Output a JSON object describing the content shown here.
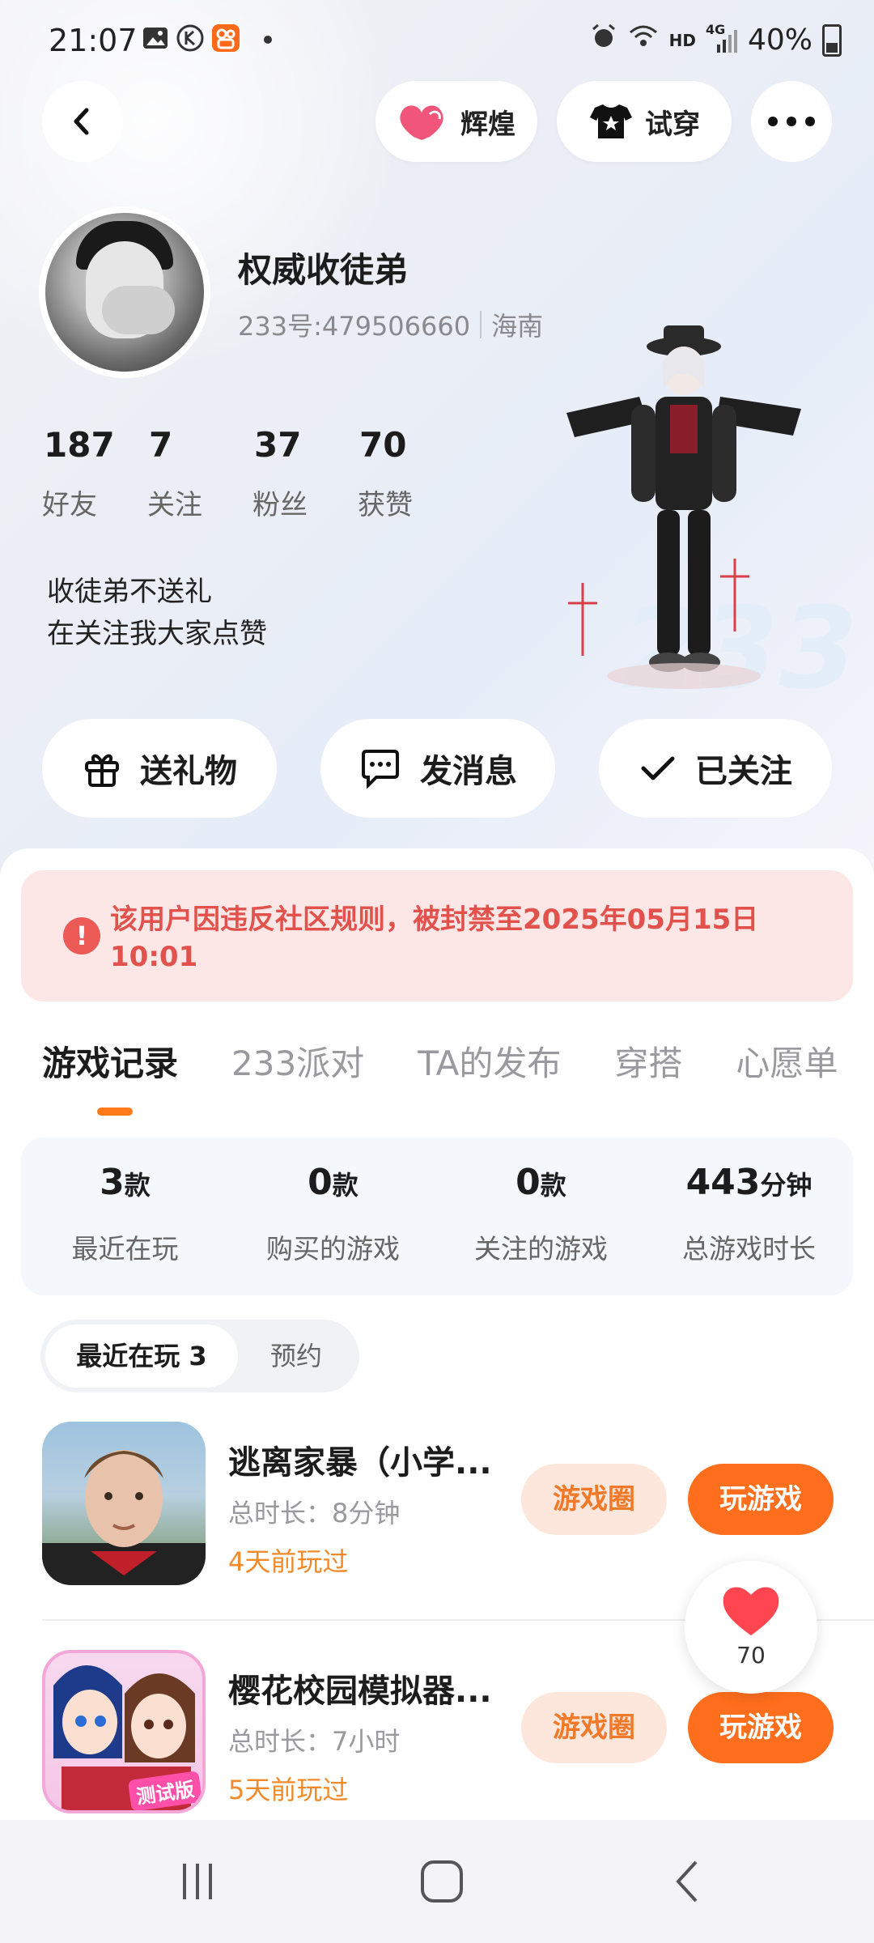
{
  "status_bar": {
    "time": "21:07",
    "network": "HD",
    "signal": "4G",
    "battery": "40%",
    "icons": [
      "gallery-icon",
      "k-app-icon",
      "kuaishou-icon",
      "alarm-icon",
      "wifi-icon",
      "battery-icon"
    ]
  },
  "header": {
    "back_icon": "chevron-left-icon",
    "glory_label": "辉煌",
    "tryon_label": "试穿",
    "more_icon": "more-dots-icon"
  },
  "profile": {
    "name": "权威收徒弟",
    "id_text": "233号:479506660",
    "region": "海南",
    "bio_line1": "收徒弟不送礼",
    "bio_line2": "在关注我大家点赞"
  },
  "stats": [
    {
      "num": "187",
      "label": "好友"
    },
    {
      "num": "7",
      "label": "关注"
    },
    {
      "num": "37",
      "label": "粉丝"
    },
    {
      "num": "70",
      "label": "获赞"
    }
  ],
  "actions": {
    "gift": "送礼物",
    "message": "发消息",
    "followed": "已关注"
  },
  "ban_notice": {
    "text": "该用户因违反社区规则，被封禁至2025年05月15日 10:01"
  },
  "tabs": [
    "游戏记录",
    "233派对",
    "TA的发布",
    "穿搭",
    "心愿单"
  ],
  "summary": [
    {
      "value": "3",
      "unit": "款",
      "label": "最近在玩"
    },
    {
      "value": "0",
      "unit": "款",
      "label": "购买的游戏"
    },
    {
      "value": "0",
      "unit": "款",
      "label": "关注的游戏"
    },
    {
      "value": "443",
      "unit": "分钟",
      "label": "总游戏时长"
    }
  ],
  "segment": {
    "active": "最近在玩 3",
    "inactive": "预约"
  },
  "games": [
    {
      "title": "逃离家暴（小学...",
      "duration": "总时长：8分钟",
      "last_played": "4天前玩过",
      "circle_label": "游戏圈",
      "play_label": "玩游戏"
    },
    {
      "title": "樱花校园模拟器...",
      "duration": "总时长：7小时",
      "last_played": "5天前玩过",
      "circle_label": "游戏圈",
      "play_label": "玩游戏",
      "badge": "测试版"
    }
  ],
  "like_bubble": {
    "count": "70"
  },
  "deco_text": "233",
  "colors": {
    "accent": "#ff6e1c",
    "ban_red": "#e2524c",
    "ban_bg": "#fde6e6"
  }
}
